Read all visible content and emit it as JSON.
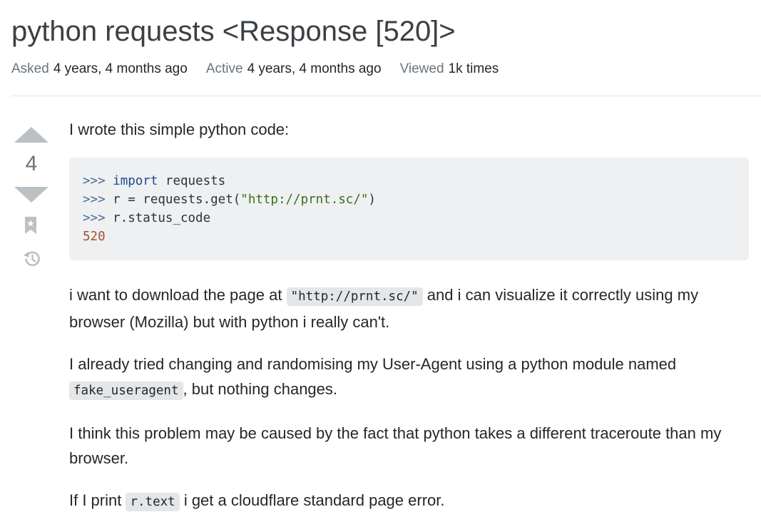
{
  "question": {
    "title": "python requests <Response [520]>",
    "meta": {
      "asked_label": "Asked",
      "asked_value": "4 years, 4 months ago",
      "active_label": "Active",
      "active_value": "4 years, 4 months ago",
      "viewed_label": "Viewed",
      "viewed_value": "1k times"
    },
    "vote_count": "4",
    "body": {
      "intro": "I wrote this simple python code:",
      "code": {
        "line1_prompt": ">>> ",
        "line1_kw": "import",
        "line1_rest": " requests",
        "line2_prompt": ">>> ",
        "line2_pre": "r = requests.get(",
        "line2_str": "\"http://prnt.sc/\"",
        "line2_post": ")",
        "line3_prompt": ">>> ",
        "line3_rest": "r.status_code",
        "line4_num": "520"
      },
      "para1_pre": "i want to download the page at ",
      "para1_code": "\"http://prnt.sc/\"",
      "para1_post": " and i can visualize it correctly using my browser (Mozilla) but with python i really can't.",
      "para2_pre": "I already tried changing and randomising my User-Agent using a python module named ",
      "para2_code": "fake_useragent",
      "para2_post": ", but nothing changes.",
      "para3": "I think this problem may be caused by the fact that python takes a different traceroute than my browser.",
      "para4_pre": "If I print ",
      "para4_code": "r.text",
      "para4_post": " i get a cloudflare standard page error."
    }
  },
  "icons": {
    "upvote": "caret-up-icon",
    "downvote": "caret-down-icon",
    "bookmark": "bookmark-icon",
    "history": "history-icon"
  },
  "colors": {
    "vote_arrow": "#bbc0c4",
    "code_bg": "#eff0f1",
    "inline_code_bg": "#e4e6e8",
    "muted_text": "#6a737c"
  }
}
